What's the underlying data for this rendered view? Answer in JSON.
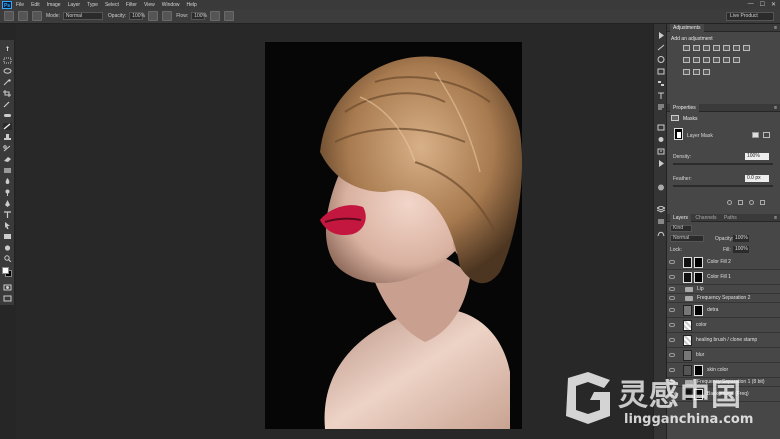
{
  "app": {
    "logo": "Ps"
  },
  "menu": [
    "File",
    "Edit",
    "Image",
    "Layer",
    "Type",
    "Select",
    "Filter",
    "View",
    "Window",
    "Help"
  ],
  "window_controls": [
    "—",
    "☐",
    "✕"
  ],
  "options_bar": {
    "mode_label": "Mode:",
    "mode_value": "Normal",
    "opacity_label": "Opacity:",
    "opacity_value": "100%",
    "flow_label": "Flow:",
    "flow_value": "100%",
    "workspace": "Live Product"
  },
  "panels": {
    "adjustments_tab": "Adjustments",
    "adjustments_title": "Add an adjustment",
    "properties_tab": "Properties",
    "masks_label": "Masks",
    "layer_mask_label": "Layer Mask",
    "density_label": "Density:",
    "density_value": "100%",
    "feather_label": "Feather:",
    "feather_value": "0.0 px",
    "layers_tabs": [
      "Layers",
      "Channels",
      "Paths"
    ],
    "kind_label": "Kind",
    "blend_mode": "Normal",
    "opacity_label": "Opacity:",
    "opacity_value": "100%",
    "lock_label": "Lock:",
    "fill_label": "Fill:",
    "fill_value": "100%"
  },
  "layers": [
    {
      "name": "Color Fill 2",
      "type": "fill"
    },
    {
      "name": "Color Fill 1",
      "type": "fill"
    },
    {
      "name": "Lip",
      "type": "group"
    },
    {
      "name": "Frequency Separation 2",
      "type": "group"
    },
    {
      "name": "detra",
      "type": "mask"
    },
    {
      "name": "color",
      "type": "pixel"
    },
    {
      "name": "healing brush / clone stamp",
      "type": "pixel"
    },
    {
      "name": "blur",
      "type": "pixel"
    },
    {
      "name": "skin color",
      "type": "mask"
    },
    {
      "name": "Frequency Separation 1 (8 bit)",
      "type": "group"
    },
    {
      "name": "Background (Freq)",
      "type": "mask"
    }
  ],
  "watermark": {
    "cn": "灵感中国",
    "url": "lingganchina.com"
  },
  "colors": {
    "accent": "#31a8ff",
    "panel": "#474747",
    "lips": "#c4173f"
  }
}
